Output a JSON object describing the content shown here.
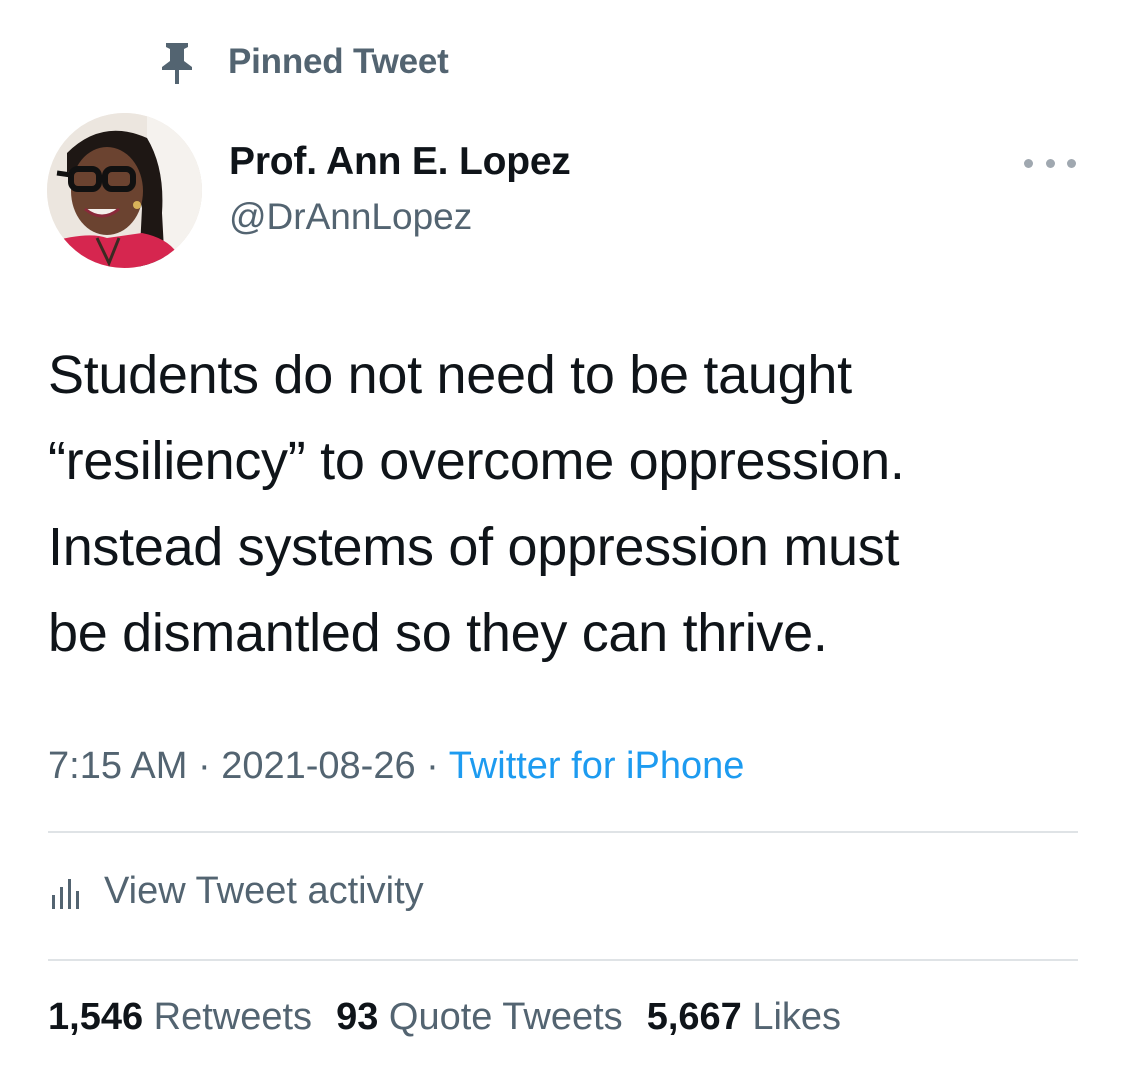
{
  "pinned": {
    "label": "Pinned Tweet",
    "icon": "pin-icon"
  },
  "author": {
    "display_name": "Prof. Ann E. Lopez",
    "handle": "@DrAnnLopez"
  },
  "more": {
    "icon": "more-horizontal-icon"
  },
  "tweet": {
    "lines": [
      "Students do not need to be taught",
      "“resiliency” to overcome oppression.",
      "Instead systems of oppression must",
      "be dismantled so they can thrive."
    ]
  },
  "meta": {
    "time": "7:15 AM",
    "separator": " · ",
    "date": "2021-08-26",
    "source": "Twitter for iPhone"
  },
  "activity": {
    "label": "View Tweet activity",
    "icon": "analytics-bars-icon"
  },
  "stats": {
    "retweets": {
      "count": "1,546",
      "label": "Retweets"
    },
    "quotes": {
      "count": "93",
      "label": "Quote Tweets"
    },
    "likes": {
      "count": "5,667",
      "label": "Likes"
    }
  },
  "colors": {
    "text_primary": "#0f1419",
    "text_secondary": "#536471",
    "link": "#1d9bf0",
    "divider": "#dfe3e6"
  }
}
